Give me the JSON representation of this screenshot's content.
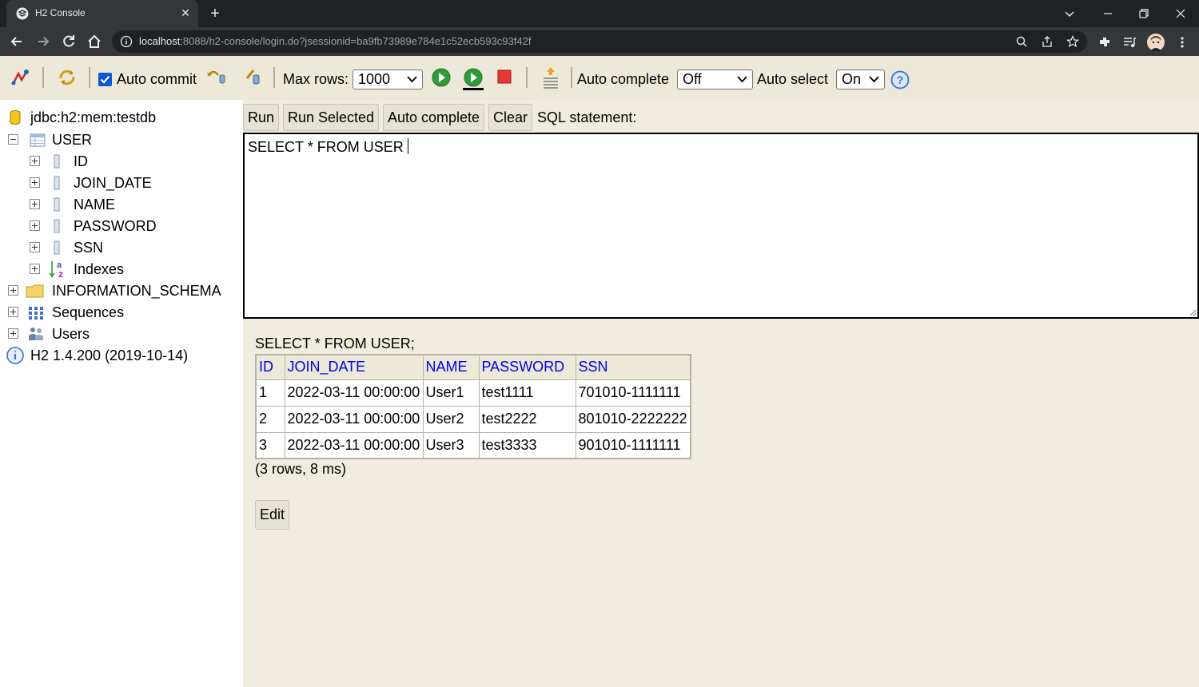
{
  "browser": {
    "tab_title": "H2 Console",
    "url_host": "localhost",
    "url_rest": ":8088/h2-console/login.do?jsessionid=ba9fb73989e784e1c52ecb593c93f42f"
  },
  "toolbar": {
    "auto_commit_label": "Auto commit",
    "auto_commit_checked": true,
    "max_rows_label": "Max rows:",
    "max_rows_value": "1000",
    "auto_complete_label": "Auto complete",
    "auto_complete_value": "Off",
    "auto_select_label": "Auto select",
    "auto_select_value": "On"
  },
  "tree": {
    "connection": "jdbc:h2:mem:testdb",
    "table": "USER",
    "columns": [
      "ID",
      "JOIN_DATE",
      "NAME",
      "PASSWORD",
      "SSN"
    ],
    "indexes": "Indexes",
    "schema": "INFORMATION_SCHEMA",
    "sequences": "Sequences",
    "users": "Users",
    "version": "H2 1.4.200 (2019-10-14)"
  },
  "editor": {
    "buttons": {
      "run": "Run",
      "run_selected": "Run Selected",
      "auto_complete": "Auto complete",
      "clear": "Clear"
    },
    "sql_label": "SQL statement:",
    "sql_text": "SELECT * FROM USER"
  },
  "result": {
    "statement": "SELECT * FROM USER;",
    "headers": [
      "ID",
      "JOIN_DATE",
      "NAME",
      "PASSWORD",
      "SSN"
    ],
    "rows": [
      [
        "1",
        "2022-03-11 00:00:00",
        "User1",
        "test1111",
        "701010-1111111"
      ],
      [
        "2",
        "2022-03-11 00:00:00",
        "User2",
        "test2222",
        "801010-2222222"
      ],
      [
        "3",
        "2022-03-11 00:00:00",
        "User3",
        "test3333",
        "901010-1111111"
      ]
    ],
    "summary": "(3 rows, 8 ms)",
    "edit_label": "Edit"
  }
}
